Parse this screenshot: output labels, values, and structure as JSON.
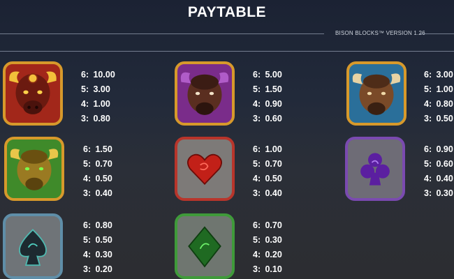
{
  "header": {
    "title": "PAYTABLE",
    "version": "BISON BLOCKS™ VERSION 1.26"
  },
  "symbols": [
    {
      "icon": "red-bison-icon",
      "frame": "#d7992b",
      "bg": "#a2271a",
      "pays": [
        {
          "count": "6:",
          "value": "10.00"
        },
        {
          "count": "5:",
          "value": "3.00"
        },
        {
          "count": "4:",
          "value": "1.00"
        },
        {
          "count": "3:",
          "value": "0.80"
        }
      ]
    },
    {
      "icon": "purple-bison-icon",
      "frame": "#d7992b",
      "bg": "#7a2c8a",
      "pays": [
        {
          "count": "6:",
          "value": "5.00"
        },
        {
          "count": "5:",
          "value": "1.50"
        },
        {
          "count": "4:",
          "value": "0.90"
        },
        {
          "count": "3:",
          "value": "0.60"
        }
      ]
    },
    {
      "icon": "blue-bison-icon",
      "frame": "#d7992b",
      "bg": "#2a6f9a",
      "pays": [
        {
          "count": "6:",
          "value": "3.00"
        },
        {
          "count": "5:",
          "value": "1.00"
        },
        {
          "count": "4:",
          "value": "0.80"
        },
        {
          "count": "3:",
          "value": "0.50"
        }
      ]
    },
    {
      "icon": "gold-bison-icon",
      "frame": "#d7992b",
      "bg": "#3f8a2a",
      "pays": [
        {
          "count": "6:",
          "value": "1.50"
        },
        {
          "count": "5:",
          "value": "0.70"
        },
        {
          "count": "4:",
          "value": "0.50"
        },
        {
          "count": "3:",
          "value": "0.40"
        }
      ]
    },
    {
      "icon": "heart-icon",
      "frame": "#b8352b",
      "bg": "#7d7a78",
      "pays": [
        {
          "count": "6:",
          "value": "1.00"
        },
        {
          "count": "5:",
          "value": "0.70"
        },
        {
          "count": "4:",
          "value": "0.50"
        },
        {
          "count": "3:",
          "value": "0.40"
        }
      ]
    },
    {
      "icon": "club-icon",
      "frame": "#7a4ab0",
      "bg": "#6e6c76",
      "pays": [
        {
          "count": "6:",
          "value": "0.90"
        },
        {
          "count": "5:",
          "value": "0.60"
        },
        {
          "count": "4:",
          "value": "0.40"
        },
        {
          "count": "3:",
          "value": "0.30"
        }
      ]
    },
    {
      "icon": "spade-icon",
      "frame": "#5f8ea8",
      "bg": "#6f7478",
      "pays": [
        {
          "count": "6:",
          "value": "0.80"
        },
        {
          "count": "5:",
          "value": "0.50"
        },
        {
          "count": "4:",
          "value": "0.30"
        },
        {
          "count": "3:",
          "value": "0.20"
        }
      ]
    },
    {
      "icon": "diamond-icon",
      "frame": "#3f9a3a",
      "bg": "#6f7670",
      "pays": [
        {
          "count": "6:",
          "value": "0.70"
        },
        {
          "count": "5:",
          "value": "0.30"
        },
        {
          "count": "4:",
          "value": "0.20"
        },
        {
          "count": "3:",
          "value": "0.10"
        }
      ]
    }
  ]
}
